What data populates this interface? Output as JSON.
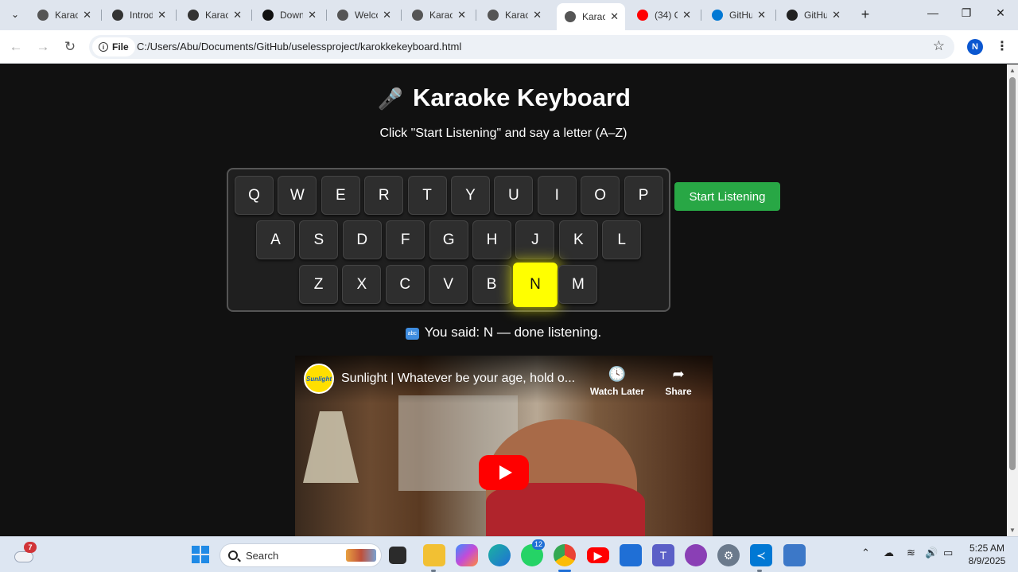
{
  "browser": {
    "tabs": [
      {
        "title": "Karao",
        "icon": "globe-icon",
        "active": false
      },
      {
        "title": "Introd",
        "icon": "openai-icon",
        "active": false
      },
      {
        "title": "Karao",
        "icon": "openai-icon",
        "active": false
      },
      {
        "title": "Down",
        "icon": "github-dark-icon",
        "active": false
      },
      {
        "title": "Welco",
        "icon": "globe-icon",
        "active": false
      },
      {
        "title": "Karao",
        "icon": "globe-icon",
        "active": false
      },
      {
        "title": "Karao",
        "icon": "globe-icon",
        "active": false
      },
      {
        "title": "Karao",
        "icon": "globe-icon",
        "active": true
      },
      {
        "title": "(34) C",
        "icon": "youtube-icon",
        "active": false
      },
      {
        "title": "GitHu",
        "icon": "vscode-icon",
        "active": false
      },
      {
        "title": "GitHu",
        "icon": "github-icon",
        "active": false
      }
    ],
    "new_tab": "+",
    "address": {
      "chip_label": "File",
      "url": "C:/Users/Abu/Documents/GitHub/uselessproject/karokkekeyboard.html"
    },
    "profile_initial": "N",
    "window_controls": {
      "minimize": "—",
      "restore": "❐",
      "close": "✕"
    }
  },
  "page": {
    "title_icon": "microphone-icon",
    "title": "Karaoke Keyboard",
    "subtitle": "Click \"Start Listening\" and say a letter (A–Z)",
    "keyboard": {
      "rows": [
        [
          "Q",
          "W",
          "E",
          "R",
          "T",
          "Y",
          "U",
          "I",
          "O",
          "P"
        ],
        [
          "A",
          "S",
          "D",
          "F",
          "G",
          "H",
          "J",
          "K",
          "L"
        ],
        [
          "Z",
          "X",
          "C",
          "V",
          "B",
          "N",
          "M"
        ]
      ],
      "highlighted": "N",
      "highlight_color": "#ffff00"
    },
    "start_button": "Start Listening",
    "start_button_color": "#28a745",
    "status_icon": "abc-icon",
    "status_text": "You said: N — done listening.",
    "video": {
      "channel_logo_text": "Sunlight",
      "title": "Sunlight | Whatever be your age, hold o...",
      "watch_later": "Watch Later",
      "share": "Share"
    }
  },
  "taskbar": {
    "weather_badge": "7",
    "search_placeholder": "Search",
    "whatsapp_badge": "12",
    "clock_time": "5:25 AM",
    "clock_date": "8/9/2025"
  }
}
